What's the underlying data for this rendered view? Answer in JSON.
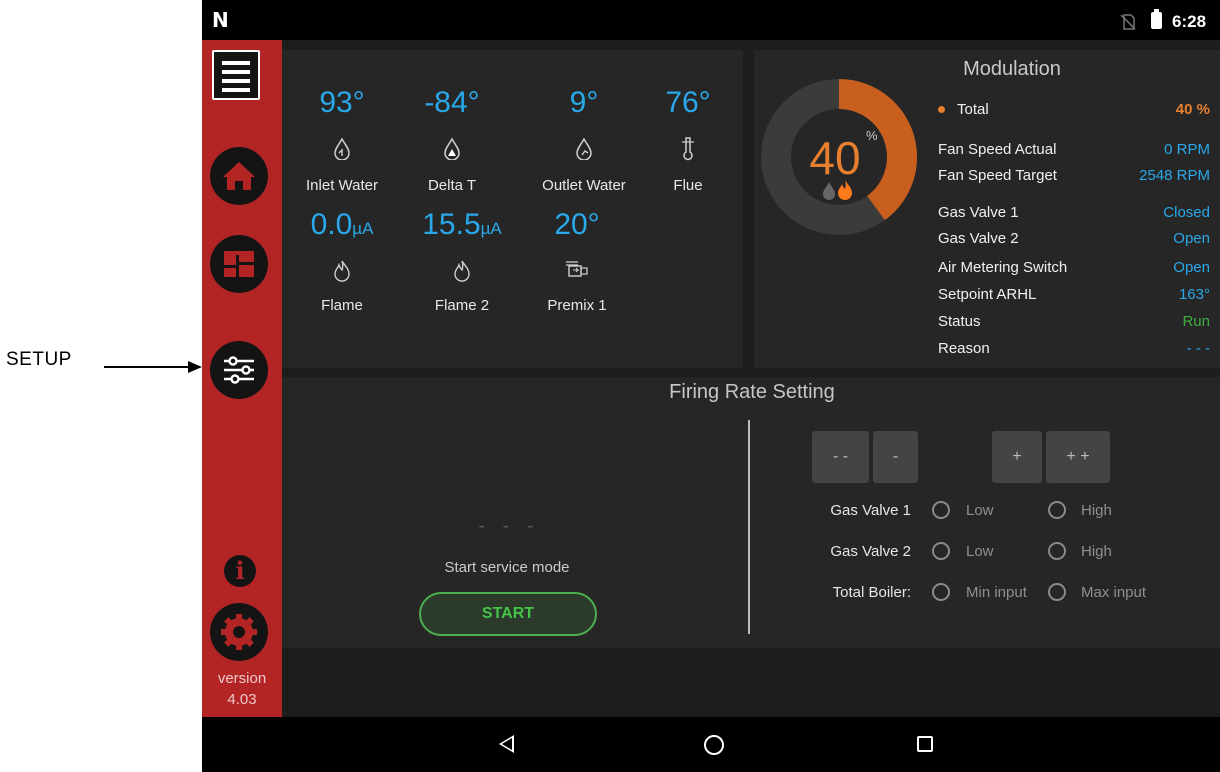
{
  "annotation": {
    "label": "SETUP"
  },
  "status_bar": {
    "logo": "N",
    "time": "6:28"
  },
  "sidebar": {
    "version_label": "version",
    "version_number": "4.03"
  },
  "sensors": [
    {
      "value": "93°",
      "unit": "",
      "label": "Inlet Water"
    },
    {
      "value": "-84°",
      "unit": "",
      "label": "Delta T"
    },
    {
      "value": "9°",
      "unit": "",
      "label": "Outlet Water"
    },
    {
      "value": "76°",
      "unit": "",
      "label": "Flue"
    },
    {
      "value": "0.0",
      "unit": "µA",
      "label": "Flame"
    },
    {
      "value": "15.5",
      "unit": "µA",
      "label": "Flame 2"
    },
    {
      "value": "20°",
      "unit": "",
      "label": "Premix 1"
    }
  ],
  "modulation": {
    "title": "Modulation",
    "gauge_value": "40",
    "gauge_unit": "%",
    "gauge_fraction": 0.4,
    "total_label": "Total",
    "total_value": "40 %",
    "rows": [
      {
        "label": "Fan Speed Actual",
        "value": "0 RPM",
        "color": "#29a8ea"
      },
      {
        "label": "Fan Speed Target",
        "value": "2548 RPM",
        "color": "#29a8ea"
      },
      {
        "label": "Gas Valve 1",
        "value": "Closed",
        "color": "#29a8ea"
      },
      {
        "label": "Gas Valve 2",
        "value": "Open",
        "color": "#29a8ea"
      },
      {
        "label": "Air Metering Switch",
        "value": "Open",
        "color": "#29a8ea"
      },
      {
        "label": "Setpoint ARHL",
        "value": "163°",
        "color": "#29a8ea"
      },
      {
        "label": "Status",
        "value": "Run",
        "color": "#3fae3f"
      },
      {
        "label": "Reason",
        "value": "- - -",
        "color": "#29a8ea"
      }
    ]
  },
  "firing": {
    "title": "Firing Rate Setting",
    "dashes": "- - -",
    "service_text": "Start service mode",
    "start_label": "START",
    "buttons": {
      "dec_big": "- -",
      "dec": "-",
      "inc": "+",
      "inc_big": "+ +"
    },
    "gas_valve_1": {
      "label": "Gas Valve 1",
      "low": "Low",
      "high": "High"
    },
    "gas_valve_2": {
      "label": "Gas Valve 2",
      "low": "Low",
      "high": "High"
    },
    "total_boiler": {
      "label": "Total Boiler:",
      "min": "Min input",
      "max": "Max input"
    }
  },
  "colors": {
    "accent_blue": "#29a8ea",
    "accent_orange": "#e87f2f",
    "sidebar_red": "#b32524",
    "run_green": "#3fae3f"
  }
}
